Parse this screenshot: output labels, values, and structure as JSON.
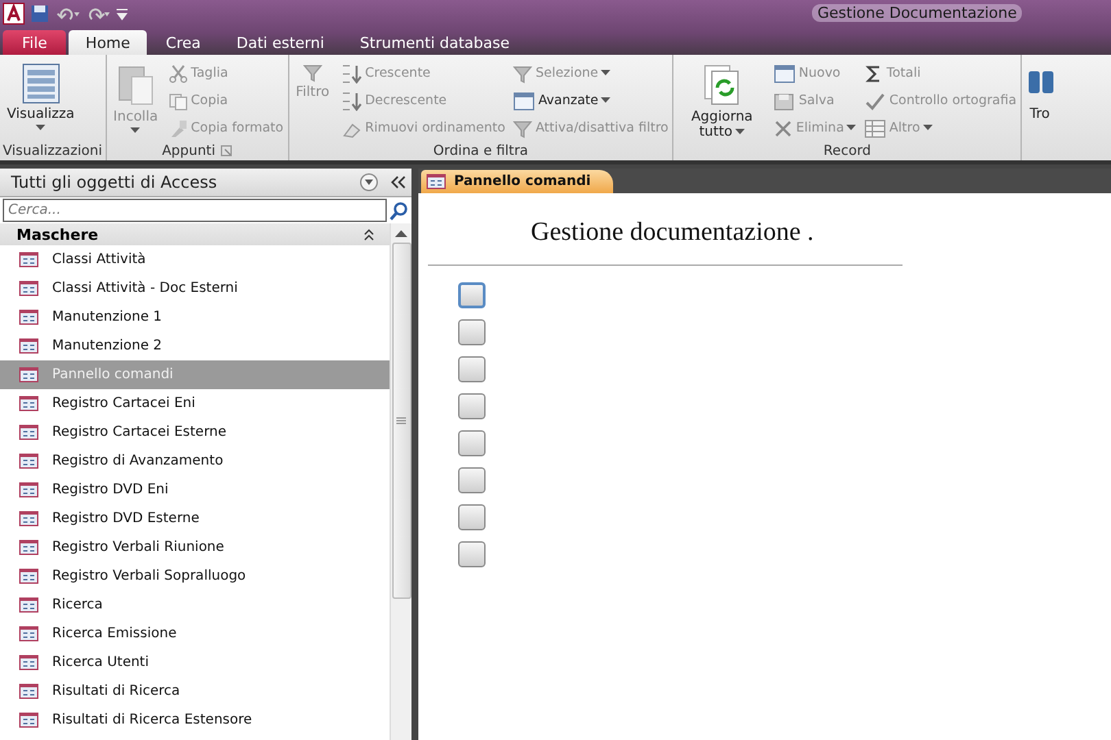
{
  "window": {
    "title": "Gestione Documentazione"
  },
  "ribbon_tabs": [
    {
      "label": "File",
      "kind": "file",
      "selected": false
    },
    {
      "label": "Home",
      "kind": "tab",
      "selected": true
    },
    {
      "label": "Crea",
      "kind": "tab",
      "selected": false
    },
    {
      "label": "Dati esterni",
      "kind": "tab",
      "selected": false
    },
    {
      "label": "Strumenti database",
      "kind": "tab",
      "selected": false
    }
  ],
  "ribbon_groups": [
    {
      "label": "Visualizzazioni",
      "items": [
        {
          "label": "Visualizza",
          "kind": "large",
          "disabled": false,
          "dropdown": true
        }
      ]
    },
    {
      "label": "Appunti",
      "launcher": true,
      "items": [
        {
          "label": "Incolla",
          "kind": "large",
          "disabled": true,
          "dropdown": true
        },
        {
          "label": "Taglia",
          "kind": "small",
          "disabled": true,
          "dropdown": false
        },
        {
          "label": "Copia",
          "kind": "small",
          "disabled": true,
          "dropdown": false
        },
        {
          "label": "Copia formato",
          "kind": "small",
          "disabled": true,
          "dropdown": false
        }
      ]
    },
    {
      "label": "Ordina e filtra",
      "items": [
        {
          "label": "Filtro",
          "kind": "large",
          "disabled": true,
          "dropdown": false
        },
        {
          "label": "Crescente",
          "kind": "small",
          "disabled": true,
          "dropdown": false
        },
        {
          "label": "Decrescente",
          "kind": "small",
          "disabled": true,
          "dropdown": false
        },
        {
          "label": "Rimuovi ordinamento",
          "kind": "small",
          "disabled": true,
          "dropdown": false
        },
        {
          "label": "Selezione",
          "kind": "small",
          "disabled": true,
          "dropdown": true
        },
        {
          "label": "Avanzate",
          "kind": "small",
          "disabled": false,
          "dropdown": true
        },
        {
          "label": "Attiva/disattiva filtro",
          "kind": "small",
          "disabled": true,
          "dropdown": false
        }
      ]
    },
    {
      "label": "Record",
      "items": [
        {
          "label": "Aggiorna tutto",
          "kind": "large",
          "disabled": false,
          "dropdown": true
        },
        {
          "label": "Nuovo",
          "kind": "small",
          "disabled": true,
          "dropdown": false
        },
        {
          "label": "Salva",
          "kind": "small",
          "disabled": true,
          "dropdown": false
        },
        {
          "label": "Elimina",
          "kind": "small",
          "disabled": true,
          "dropdown": true
        },
        {
          "label": "Totali",
          "kind": "small",
          "disabled": true,
          "dropdown": false
        },
        {
          "label": "Controllo ortografia",
          "kind": "small",
          "disabled": true,
          "dropdown": false
        },
        {
          "label": "Altro",
          "kind": "small",
          "disabled": true,
          "dropdown": true
        }
      ]
    },
    {
      "items": [
        {
          "label": "Tro",
          "kind": "large",
          "disabled": false,
          "dropdown": false
        }
      ]
    }
  ],
  "navigation": {
    "title": "Tutti gli oggetti di Access",
    "search": {
      "placeholder": "Cerca..."
    },
    "group": "Maschere",
    "items": [
      {
        "label": "Classi Attività",
        "selected": false
      },
      {
        "label": "Classi Attività - Doc Esterni",
        "selected": false
      },
      {
        "label": "Manutenzione 1",
        "selected": false
      },
      {
        "label": "Manutenzione 2",
        "selected": false
      },
      {
        "label": "Pannello comandi",
        "selected": true
      },
      {
        "label": "Registro Cartacei Eni",
        "selected": false
      },
      {
        "label": "Registro Cartacei Esterne",
        "selected": false
      },
      {
        "label": "Registro di Avanzamento",
        "selected": false
      },
      {
        "label": "Registro DVD Eni",
        "selected": false
      },
      {
        "label": "Registro DVD Esterne",
        "selected": false
      },
      {
        "label": "Registro Verbali Riunione",
        "selected": false
      },
      {
        "label": "Registro Verbali Sopralluogo",
        "selected": false
      },
      {
        "label": "Ricerca",
        "selected": false
      },
      {
        "label": "Ricerca Emissione",
        "selected": false
      },
      {
        "label": "Ricerca Utenti",
        "selected": false
      },
      {
        "label": "Risultati di Ricerca",
        "selected": false
      },
      {
        "label": "Risultati di Ricerca Estensore",
        "selected": false
      }
    ]
  },
  "document": {
    "tab": "Pannello comandi",
    "heading": "Gestione documentazione .",
    "buttons": [
      {
        "focused": true
      },
      {
        "focused": false
      },
      {
        "focused": false
      },
      {
        "focused": false
      },
      {
        "focused": false
      },
      {
        "focused": false
      },
      {
        "focused": false
      },
      {
        "focused": false
      }
    ]
  }
}
